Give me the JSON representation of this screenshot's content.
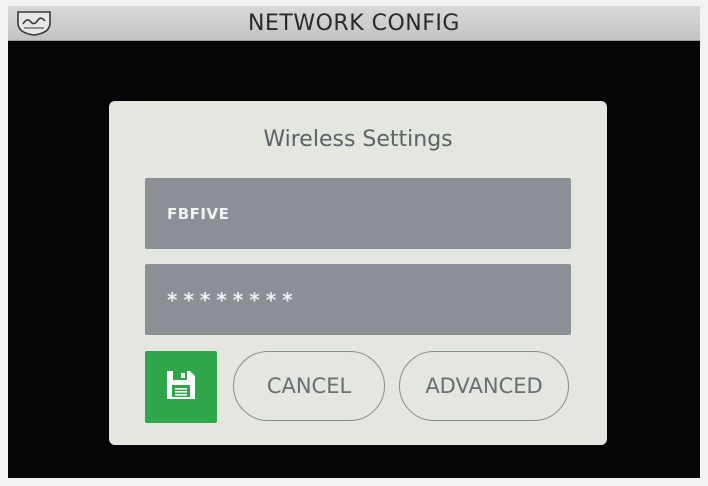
{
  "header": {
    "title": "NETWORK CONFIG",
    "logo": "brand-logo-icon"
  },
  "dialog": {
    "title": "Wireless Settings",
    "ssid_value": "FBFIVE",
    "password_value": "********",
    "save_icon": "save-floppy-icon",
    "cancel_label": "CANCEL",
    "advanced_label": "ADVANCED"
  },
  "colors": {
    "screen_background": "#050505",
    "titlebar": "#cfcfcd",
    "dialog_background": "#e4e6e0",
    "field_background": "#8a9096",
    "save_button": "#2fa64a",
    "pill_text": "#6a6e72"
  }
}
